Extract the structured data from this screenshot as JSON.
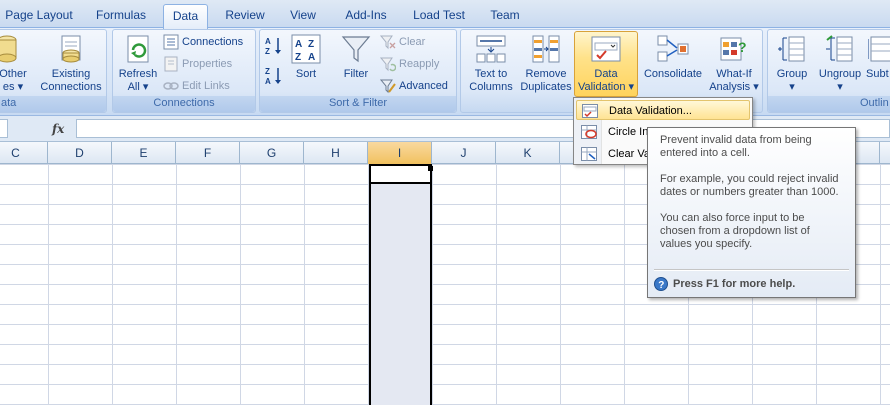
{
  "tabs": [
    {
      "label": "Page Layout"
    },
    {
      "label": "Formulas"
    },
    {
      "label": "Data",
      "active": true
    },
    {
      "label": "Review"
    },
    {
      "label": "View"
    },
    {
      "label": "Add-Ins"
    },
    {
      "label": "Load Test"
    },
    {
      "label": "Team"
    }
  ],
  "ribbon": {
    "get_external": {
      "from_other_line1": "Other",
      "from_other_line2": "es ▾",
      "existing_line1": "Existing",
      "existing_line2": "Connections",
      "label": "ata"
    },
    "connections": {
      "refresh_line1": "Refresh",
      "refresh_line2": "All ▾",
      "connections": "Connections",
      "properties": "Properties",
      "edit_links": "Edit Links",
      "label": "Connections"
    },
    "sort_filter": {
      "sort": "Sort",
      "filter": "Filter",
      "clear": "Clear",
      "reapply": "Reapply",
      "advanced": "Advanced",
      "label": "Sort & Filter"
    },
    "data_tools": {
      "text_to_columns_line1": "Text to",
      "text_to_columns_line2": "Columns",
      "remove_dup_line1": "Remove",
      "remove_dup_line2": "Duplicates",
      "data_validation_line1": "Data",
      "data_validation_line2": "Validation ▾",
      "consolidate": "Consolidate",
      "what_if_line1": "What-If",
      "what_if_line2": "Analysis ▾"
    },
    "outline": {
      "group": "Group",
      "group_arrow": "▾",
      "ungroup": "Ungroup",
      "ungroup_arrow": "▾",
      "subtotal": "Subt",
      "label": "Outlin"
    }
  },
  "formula_bar": {
    "fx": "fx",
    "value": ""
  },
  "columns": [
    "C",
    "D",
    "E",
    "F",
    "G",
    "H",
    "I",
    "J",
    "K"
  ],
  "selected_column": "I",
  "menu": {
    "items": [
      {
        "label": "Data Validation...",
        "icon": "data-validation-icon"
      },
      {
        "label": "Circle In",
        "icon": "circle-invalid-icon"
      },
      {
        "label": "Clear Va",
        "icon": "clear-validation-icon"
      }
    ]
  },
  "tooltip": {
    "p1": "Prevent invalid data from being entered into a cell.",
    "p2": "For example, you could reject invalid dates or numbers greater than 1000.",
    "p3": "You can also force input to be chosen from a dropdown list of values you specify.",
    "help": "Press F1 for more help."
  },
  "colors": {
    "ribbon": "#dbe7f7",
    "highlight": "#ffd35c",
    "selection": "#e4e8f2",
    "text": "#15428b"
  }
}
